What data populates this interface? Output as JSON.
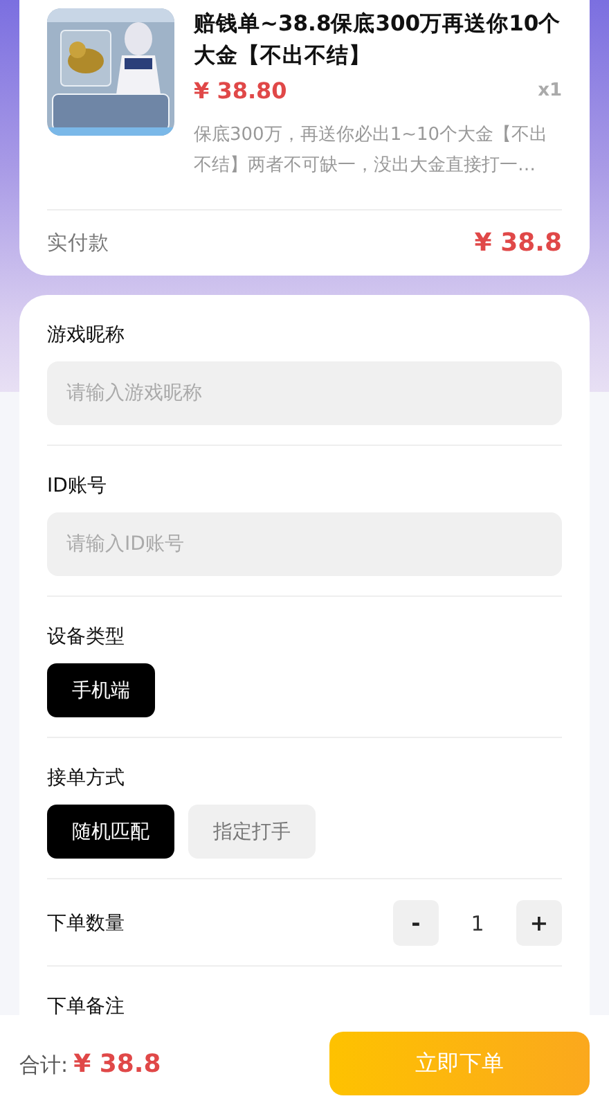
{
  "product": {
    "title": "赔钱单~38.8保底300万再送你10个大金【不出不结】",
    "price": "¥ 38.80",
    "quantity": "x1",
    "description": "保底300万，再送你必出1~10个大金【不出不结】两者不可缺一，没出大金直接打一…"
  },
  "paid": {
    "label": "实付款",
    "amount": "¥ 38.8"
  },
  "form": {
    "nickname": {
      "label": "游戏昵称",
      "placeholder": "请输入游戏昵称"
    },
    "account": {
      "label": "ID账号",
      "placeholder": "请输入ID账号"
    },
    "device": {
      "label": "设备类型",
      "options": [
        {
          "label": "手机端",
          "selected": true
        }
      ]
    },
    "mode": {
      "label": "接单方式",
      "options": [
        {
          "label": "随机匹配",
          "selected": true
        },
        {
          "label": "指定打手",
          "selected": false
        }
      ]
    },
    "quantity": {
      "label": "下单数量",
      "minus": "-",
      "value": "1",
      "plus": "+"
    },
    "note": {
      "label": "下单备注"
    }
  },
  "footer": {
    "total_label": "合计:",
    "total": "¥ 38.8",
    "submit": "立即下单"
  }
}
